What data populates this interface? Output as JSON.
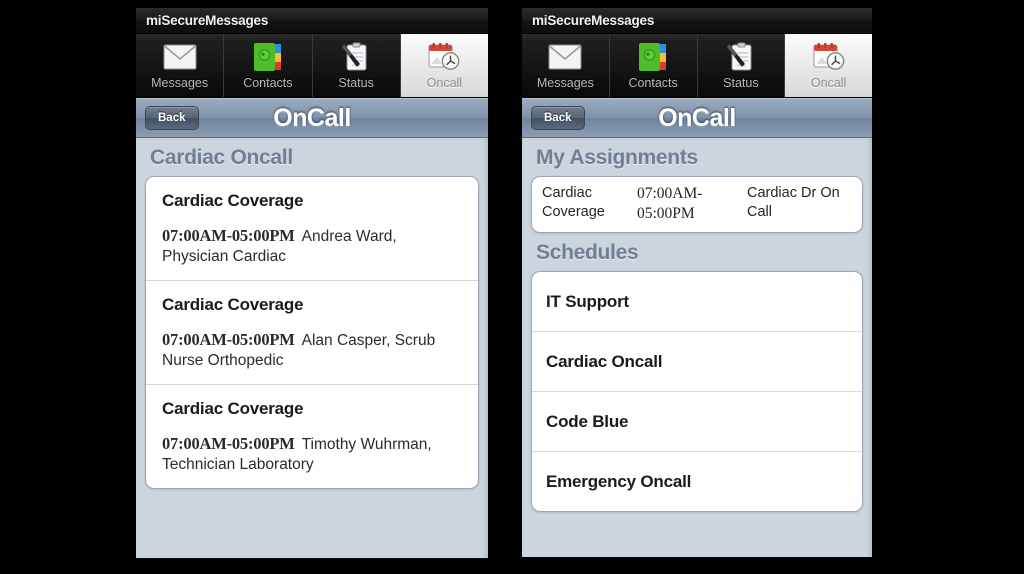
{
  "app": {
    "title": "miSecureMessages",
    "tabs": [
      {
        "label": "Messages",
        "icon": "envelope-icon",
        "selected": false
      },
      {
        "label": "Contacts",
        "icon": "address-book-icon",
        "selected": false
      },
      {
        "label": "Status",
        "icon": "clipboard-pen-icon",
        "selected": false
      },
      {
        "label": "Oncall",
        "icon": "calendar-clock-icon",
        "selected": true
      }
    ],
    "nav": {
      "back_label": "Back",
      "title": "OnCall"
    },
    "colors": {
      "navbar_blue": "#8093ab",
      "screen_bg": "#ccd4dd",
      "section_header": "#6f7f94",
      "card_white": "#ffffff",
      "tabbar_black": "#131313",
      "selected_tab": "#ececec"
    }
  },
  "left_screen": {
    "section_header": "Cardiac Oncall",
    "entries": [
      {
        "title": "Cardiac Coverage",
        "time": "07:00AM-05:00PM",
        "person": "Andrea Ward, Physician Cardiac"
      },
      {
        "title": "Cardiac Coverage",
        "time": "07:00AM-05:00PM",
        "person": "Alan Casper, Scrub Nurse Orthopedic"
      },
      {
        "title": "Cardiac Coverage",
        "time": "07:00AM-05:00PM",
        "person": "Timothy Wuhrman, Technician Laboratory"
      }
    ]
  },
  "right_screen": {
    "assignments_header": "My Assignments",
    "assignments": [
      {
        "schedule": "Cardiac Coverage",
        "time": "07:00AM-05:00PM",
        "role": "Cardiac Dr On Call"
      }
    ],
    "schedules_header": "Schedules",
    "schedules": [
      {
        "name": "IT Support"
      },
      {
        "name": "Cardiac Oncall"
      },
      {
        "name": "Code Blue"
      },
      {
        "name": "Emergency Oncall"
      }
    ]
  }
}
